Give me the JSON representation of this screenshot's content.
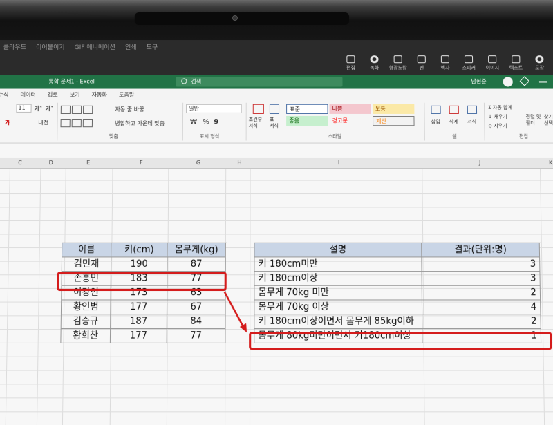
{
  "capture_app": {
    "menus": [
      "클라우드",
      "이어붙이기",
      "GIF 애니메이션",
      "인쇄",
      "도구"
    ],
    "tools": [
      {
        "label": "편집",
        "icon": "edit-icon"
      },
      {
        "label": "녹화",
        "icon": "record-icon"
      },
      {
        "label": "형광노랑",
        "icon": "highlighter-icon"
      },
      {
        "label": "펜",
        "icon": "pen-icon"
      },
      {
        "label": "액자",
        "icon": "frame-icon"
      },
      {
        "label": "스티커",
        "icon": "sticker-icon"
      },
      {
        "label": "이미지",
        "icon": "image-icon"
      },
      {
        "label": "텍스트",
        "icon": "text-icon"
      },
      {
        "label": "도장",
        "icon": "stamp-icon"
      }
    ]
  },
  "excel": {
    "title": "통합 문서1 - Excel",
    "search_placeholder": "검색",
    "user_name": "남현준",
    "tabs": [
      "수식",
      "데이터",
      "검토",
      "보기",
      "자동화",
      "도움말"
    ],
    "ribbon": {
      "font_size": "11",
      "wrap_text": "자동 줄 바꿈",
      "merge_center": "병합하고 가운데 맞춤",
      "align_group": "맞춤",
      "number_format": "일반",
      "number_group": "표시 형식",
      "conditional_format": "조건부\n서식",
      "table_format": "표\n서식",
      "styles": [
        {
          "label": "표준",
          "bg": "#ffffff",
          "fg": "#222222"
        },
        {
          "label": "나쁨",
          "bg": "#f4c7ce",
          "fg": "#9c0006"
        },
        {
          "label": "보통",
          "bg": "#fbe9a7",
          "fg": "#9c5700"
        },
        {
          "label": "좋음",
          "bg": "#c6efce",
          "fg": "#006100"
        },
        {
          "label": "경고문",
          "bg": "#f5f5f5",
          "fg": "#ff0000"
        },
        {
          "label": "계산",
          "bg": "#f2f2f2",
          "fg": "#fa7d00"
        }
      ],
      "style_group": "스타일",
      "insert": "삽입",
      "delete": "삭제",
      "format": "서식",
      "cells_group": "셀",
      "autosum": "자동 합계",
      "fill": "채우기",
      "clear": "지우기",
      "sort_filter": "정렬 및\n필터",
      "find": "찾기\n선택",
      "edit_group": "편집"
    },
    "columns": [
      "C",
      "D",
      "E",
      "F",
      "G",
      "H",
      "I",
      "J",
      "K"
    ]
  },
  "table1": {
    "headers": [
      "이름",
      "키(cm)",
      "몸무게(kg)"
    ],
    "rows": [
      [
        "김민재",
        "190",
        "87"
      ],
      [
        "손흥민",
        "183",
        "77"
      ],
      [
        "이강인",
        "173",
        "63"
      ],
      [
        "황인범",
        "177",
        "67"
      ],
      [
        "김승규",
        "187",
        "84"
      ],
      [
        "황희찬",
        "177",
        "77"
      ]
    ]
  },
  "table2": {
    "headers": [
      "설명",
      "결과(단위:명)"
    ],
    "rows": [
      [
        "키 180cm미만",
        "3"
      ],
      [
        "키 180cm이상",
        "3"
      ],
      [
        "몸무게 70kg 미만",
        "2"
      ],
      [
        "몸무게 70kg 이상",
        "4"
      ],
      [
        "키 180cm이상이면서 몸무게 85kg이하",
        "2"
      ],
      [
        "몸무게 80kg미만이면서 키180cm이상",
        "1"
      ]
    ]
  },
  "annotation": {
    "color": "#d41c1c",
    "highlighted_row_table1": 1,
    "highlighted_row_table2": 5
  }
}
